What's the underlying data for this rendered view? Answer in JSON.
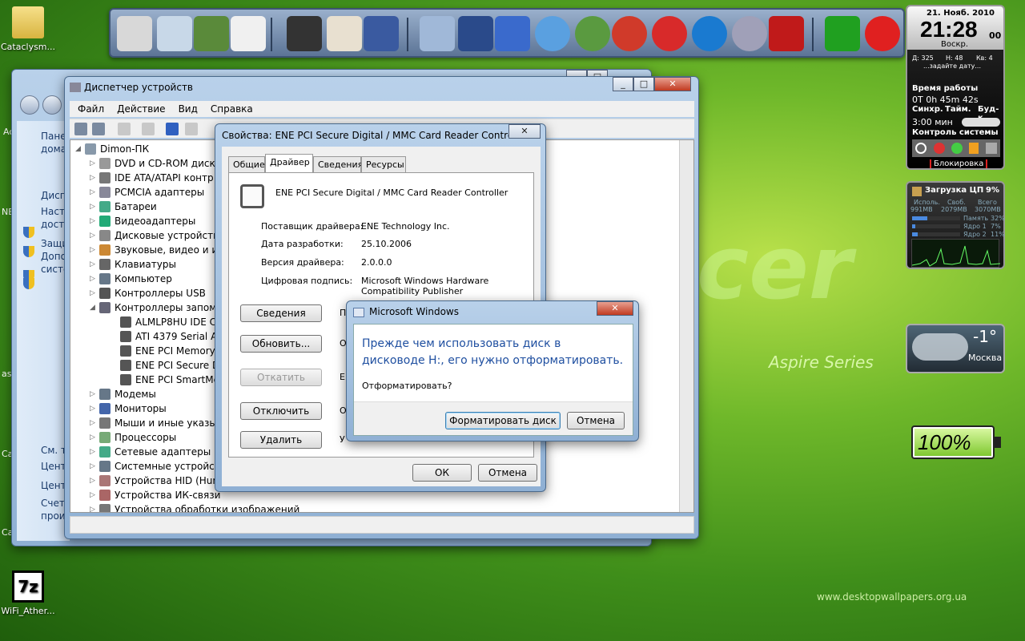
{
  "desktop": {
    "icons": [
      {
        "label": "Cataclysm..."
      },
      {
        "label": "WiFi_Ather..."
      }
    ],
    "wallpaper": {
      "brand": "cer",
      "series": "Aspire Series",
      "url": "www.desktopwallpapers.org.ua"
    },
    "edge_labels": [
      "Ac",
      "NE",
      "as",
      "Ca",
      "Ca"
    ]
  },
  "dock": {
    "icons": [
      "computer-icon",
      "recycle-bin-icon",
      "notepad-icon",
      "document-icon",
      "video-editor-icon",
      "emule-icon",
      "floppy-save-icon",
      "installer-icon",
      "virtualbox-icon",
      "tools-icon",
      "phone-icon",
      "compass-icon",
      "ccleaner-icon",
      "burner-icon",
      "teamviewer-icon",
      "sphere-icon",
      "nero-icon",
      "utorrent-icon",
      "opera-icon"
    ]
  },
  "clock_gadget": {
    "date": "21. Нояб. 2010",
    "time": "21:28",
    "seconds": "00",
    "weekday": "Воскр.",
    "day_counter": "Д: 325",
    "week_counter": "Н: 48",
    "quarter_counter": "Кв: 4",
    "hint": "...задайте дату...",
    "uptime_label": "Время работы",
    "uptime_value": "0T 0h 45m 42s",
    "sync_label": "Синхр.",
    "timer_label": "Тайм.",
    "alarm_label": "Буд-к",
    "timer_value": "3:00 мин",
    "control_label": "Контроль системы",
    "lock_label": "Блокировка"
  },
  "cpu_gadget": {
    "title": "Загрузка ЦП",
    "percent": "9%",
    "col_used": "Исполь.",
    "col_free": "Своб.",
    "col_total": "Всего",
    "used": "991MB",
    "free": "2079MB",
    "total": "3070MB",
    "rows": [
      {
        "label": "Память",
        "value": "32%",
        "level": 0.32
      },
      {
        "label": "Ядро 1",
        "value": "7%",
        "level": 0.07
      },
      {
        "label": "Ядро 2",
        "value": "11%",
        "level": 0.11
      }
    ]
  },
  "weather_gadget": {
    "temp": "-1°",
    "city": "Москва"
  },
  "battery_gadget": {
    "percent": "100%",
    "level": 1.0
  },
  "back_window": {
    "sidebar": [
      "Пане",
      "дома",
      "Дисп",
      "Наст",
      "досту",
      "Защи",
      "Допо",
      "систе",
      "См. т",
      "Цент",
      "Цент",
      "Счет",
      "прои"
    ]
  },
  "devmgr": {
    "title": "Диспетчер устройств",
    "menu": [
      "Файл",
      "Действие",
      "Вид",
      "Справка"
    ],
    "root": "Dimon-ПК",
    "items": [
      "DVD и CD-ROM диско",
      "IDE ATA/ATAPI контр",
      "PCMCIA адаптеры",
      "Батареи",
      "Видеоадаптеры",
      "Дисковые устройства",
      "Звуковые, видео и игр",
      "Клавиатуры",
      "Компьютер",
      "Контроллеры USB",
      "Контроллеры запоми",
      "ALMLP8HU IDE Co",
      "ATI 4379 Serial ATA",
      "ENE PCI Memory S",
      "ENE PCI Secure Dig",
      "ENE PCI SmartMed",
      "Модемы",
      "Мониторы",
      "Мыши и иные указы",
      "Процессоры",
      "Сетевые адаптеры",
      "Системные устройств",
      "Устройства HID (Hum",
      "Устройства ИК-связи",
      "Устройства обработки изображений"
    ]
  },
  "props": {
    "title": "Свойства: ENE PCI Secure Digital / MMC Card Reader Controller",
    "tabs": [
      "Общие",
      "Драйвер",
      "Сведения",
      "Ресурсы"
    ],
    "device_name": "ENE PCI Secure Digital / MMC Card Reader Controller",
    "fields": [
      {
        "label": "Поставщик драйвера:",
        "value": "ENE Technology Inc."
      },
      {
        "label": "Дата разработки:",
        "value": "25.10.2006"
      },
      {
        "label": "Версия драйвера:",
        "value": "2.0.0.0"
      },
      {
        "label": "Цифровая подпись:",
        "value": "Microsoft Windows Hardware Compatibility Publisher"
      }
    ],
    "buttons": [
      "Сведения",
      "Обновить...",
      "Откатить",
      "Отключить",
      "Удалить"
    ],
    "side_letters": [
      "П",
      "О",
      "Е",
      "О",
      "У"
    ],
    "ok": "ОК",
    "cancel": "Отмена"
  },
  "msgbox": {
    "title": "Microsoft Windows",
    "message": "Прежде чем использовать диск в дисководе H:, его нужно отформатировать.",
    "question": "Отформатировать?",
    "format_button": "Форматировать диск",
    "cancel_button": "Отмена"
  },
  "colors": {
    "accent_blue": "#1f4fa0",
    "close_red": "#c13a20"
  }
}
